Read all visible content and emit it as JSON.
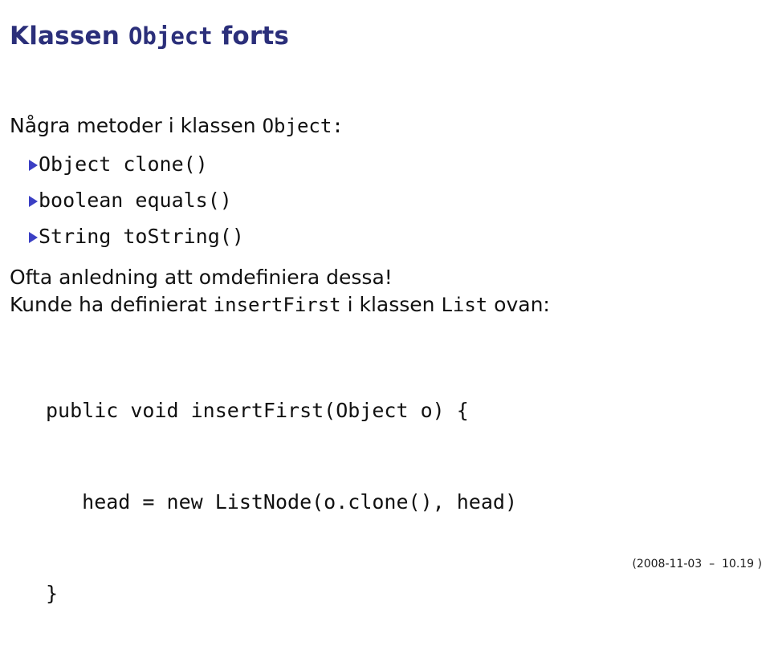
{
  "slide": {
    "title": {
      "pre": "Klassen ",
      "mono": "Object",
      "post": " forts"
    },
    "lead": {
      "pre": "Några metoder i klassen ",
      "mono": "Object:",
      "post": ""
    },
    "methods": [
      {
        "label": "Object clone()",
        "bullet_icon": "triangle-right-icon"
      },
      {
        "label": "boolean equals()",
        "bullet_icon": "triangle-right-icon"
      },
      {
        "label": "String toString()",
        "bullet_icon": "triangle-right-icon"
      }
    ],
    "paragraph": {
      "line1": "Ofta anledning att omdefiniera dessa!",
      "line2_pre": "Kunde ha definierat ",
      "line2_mono1": "insertFirst",
      "line2_mid": " i klassen ",
      "line2_mono2": "List",
      "line2_post": " ovan:"
    },
    "code": {
      "line1": "public void insertFirst(Object o) {",
      "line2": "   head = new ListNode(o.clone(), head)",
      "line3": "}"
    },
    "footer": "(2008-11-03  –  10.19 )"
  },
  "colors": {
    "title": "#2b2f7a",
    "bullet": "#3b3fc4",
    "text": "#111111",
    "background": "#ffffff"
  }
}
